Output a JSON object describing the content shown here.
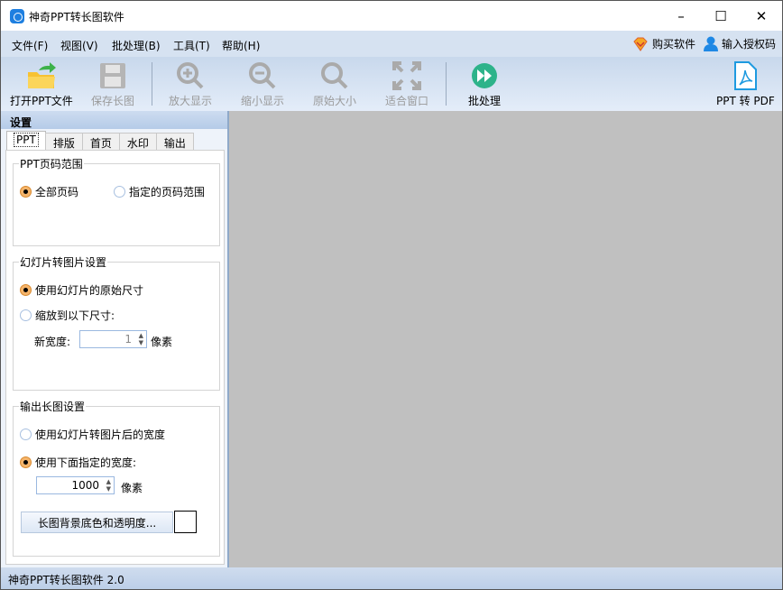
{
  "window": {
    "title": "神奇PPT转长图软件",
    "minimize": "–",
    "maximize": "☐",
    "close": "✕"
  },
  "menu": {
    "items": [
      "文件(F)",
      "视图(V)",
      "批处理(B)",
      "工具(T)",
      "帮助(H)"
    ],
    "buy": "购买软件",
    "license": "输入授权码"
  },
  "toolbar": {
    "open": "打开PPT文件",
    "save": "保存长图",
    "zoom_in": "放大显示",
    "zoom_out": "缩小显示",
    "actual_size": "原始大小",
    "fit": "适合窗口",
    "batch": "批处理",
    "to_pdf": "PPT 转 PDF"
  },
  "settings": {
    "header": "设置",
    "tabs": [
      "PPT",
      "排版",
      "首页",
      "水印",
      "输出"
    ],
    "page_range": {
      "title": "PPT页码范围",
      "all": "全部页码",
      "specified": "指定的页码范围"
    },
    "slide_image": {
      "title": "幻灯片转图片设置",
      "original": "使用幻灯片的原始尺寸",
      "scale": "缩放到以下尺寸:",
      "width_label": "新宽度:",
      "width_value": "1",
      "unit": "像素"
    },
    "output": {
      "title": "输出长图设置",
      "use_slide_width": "使用幻灯片转图片后的宽度",
      "use_specified": "使用下面指定的宽度:",
      "width_value": "1000",
      "unit": "像素",
      "bg_button": "长图背景底色和透明度..."
    }
  },
  "status": "神奇PPT转长图软件 2.0",
  "colors": {
    "accent": "#1e7fe0",
    "batch_green": "#2db38a",
    "canvas": "#c0c0c0"
  }
}
